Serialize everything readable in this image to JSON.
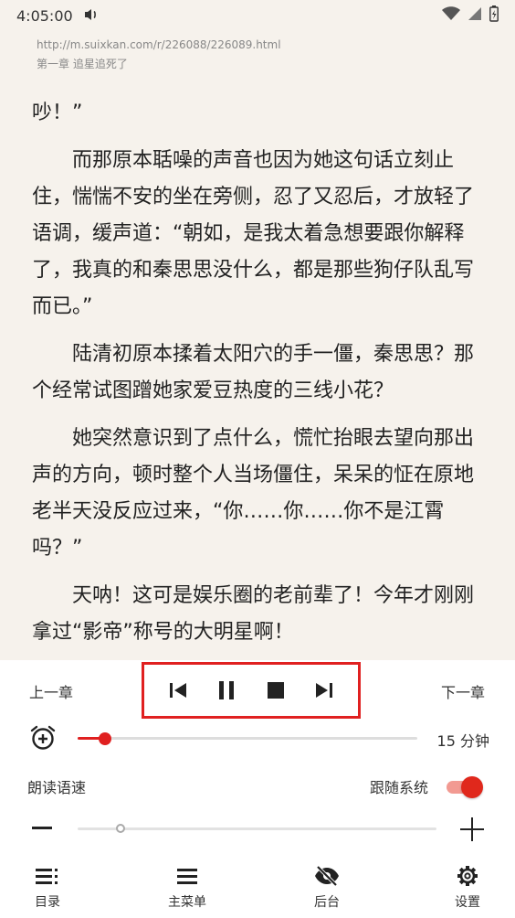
{
  "status": {
    "time": "4:05:00"
  },
  "page": {
    "url": "http://m.suixkan.com/r/226088/226089.html",
    "chapter_title": "第一章 追星追死了"
  },
  "content": {
    "paragraphs": [
      "吵！”",
      "而那原本聒噪的声音也因为她这句话立刻止住，惴惴不安的坐在旁侧，忍了又忍后，才放轻了语调，缓声道：“朝如，是我太着急想要跟你解释了，我真的和秦思思没什么，都是那些狗仔队乱写而已。”",
      "陆清初原本揉着太阳穴的手一僵，秦思思？那个经常试图蹭她家爱豆热度的三线小花？",
      "她突然意识到了点什么，慌忙抬眼去望向那出声的方向，顿时整个人当场僵住，呆呆的怔在原地老半天没反应过来，“你……你……你不是江霄吗？”",
      "天呐！这可是娱乐圈的老前辈了！今年才刚刚拿过“影帝”称号的大明星啊！"
    ]
  },
  "controls": {
    "prev_chapter": "上一章",
    "next_chapter": "下一章",
    "player_icons": [
      "skip-previous-icon",
      "pause-icon",
      "stop-icon",
      "skip-next-icon"
    ],
    "accent_color": "#e02020"
  },
  "timer": {
    "label": "15 分钟",
    "fraction": 0.08
  },
  "speed": {
    "label": "朗读语速",
    "follow_system_label": "跟随系统",
    "follow_system": true,
    "fraction": 0.12
  },
  "nav": {
    "items": [
      {
        "label": "目录",
        "icon": "toc-icon"
      },
      {
        "label": "主菜单",
        "icon": "menu-icon"
      },
      {
        "label": "后台",
        "icon": "eye-off-icon"
      },
      {
        "label": "设置",
        "icon": "gear-icon"
      }
    ]
  }
}
